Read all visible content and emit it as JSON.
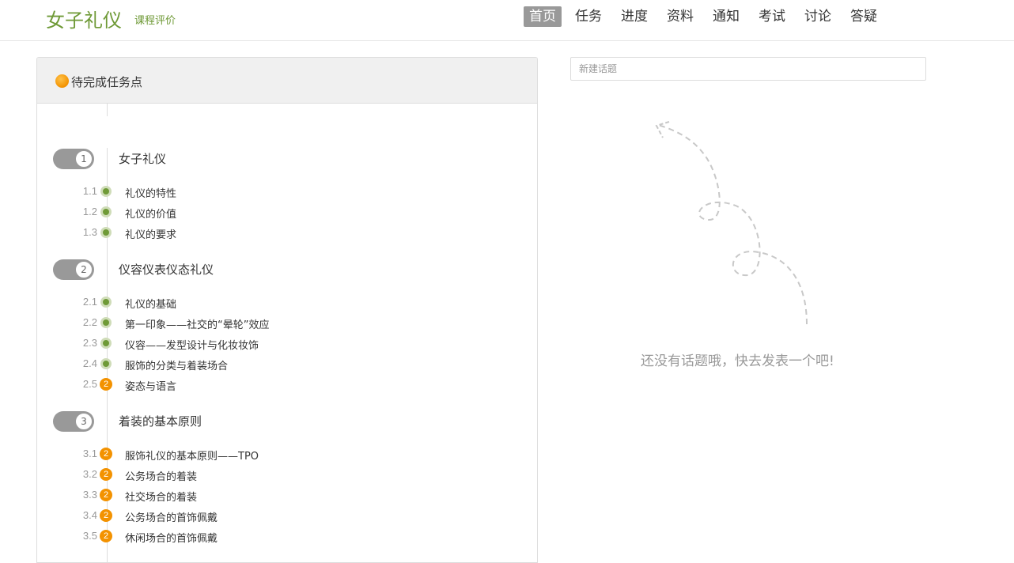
{
  "header": {
    "course_title": "女子礼仪",
    "course_eval": "课程评价",
    "nav": [
      "首页",
      "任务",
      "进度",
      "资料",
      "通知",
      "考试",
      "讨论",
      "答疑"
    ],
    "active_nav": "首页"
  },
  "panel": {
    "title": "待完成任务点"
  },
  "chapters": [
    {
      "num": "1",
      "title": "女子礼仪",
      "lessons": [
        {
          "num": "1.1",
          "title": "礼仪的特性",
          "status": "done"
        },
        {
          "num": "1.2",
          "title": "礼仪的价值",
          "status": "done"
        },
        {
          "num": "1.3",
          "title": "礼仪的要求",
          "status": "done"
        }
      ]
    },
    {
      "num": "2",
      "title": "仪容仪表仪态礼仪",
      "lessons": [
        {
          "num": "2.1",
          "title": "礼仪的基础",
          "status": "done"
        },
        {
          "num": "2.2",
          "title": "第一印象——社交的“晕轮”效应",
          "status": "done"
        },
        {
          "num": "2.3",
          "title": "仪容——发型设计与化妆妆饰",
          "status": "done"
        },
        {
          "num": "2.4",
          "title": "服饰的分类与着装场合",
          "status": "done"
        },
        {
          "num": "2.5",
          "title": "姿态与语言",
          "status": "pending",
          "badge": "2"
        }
      ]
    },
    {
      "num": "3",
      "title": "着装的基本原则",
      "lessons": [
        {
          "num": "3.1",
          "title": "服饰礼仪的基本原则——TPO",
          "status": "pending",
          "badge": "2"
        },
        {
          "num": "3.2",
          "title": "公务场合的着装",
          "status": "pending",
          "badge": "2"
        },
        {
          "num": "3.3",
          "title": "社交场合的着装",
          "status": "pending",
          "badge": "2"
        },
        {
          "num": "3.4",
          "title": "公务场合的首饰佩戴",
          "status": "pending",
          "badge": "2"
        },
        {
          "num": "3.5",
          "title": "休闲场合的首饰佩戴",
          "status": "pending",
          "badge": "2"
        }
      ]
    }
  ],
  "discussion": {
    "new_topic_placeholder": "新建话题",
    "empty_message": "还没有话题哦，快去发表一个吧!"
  },
  "colors": {
    "brand_green": "#6f9a37",
    "pending_orange": "#f39200",
    "nav_active_bg": "#999999"
  }
}
